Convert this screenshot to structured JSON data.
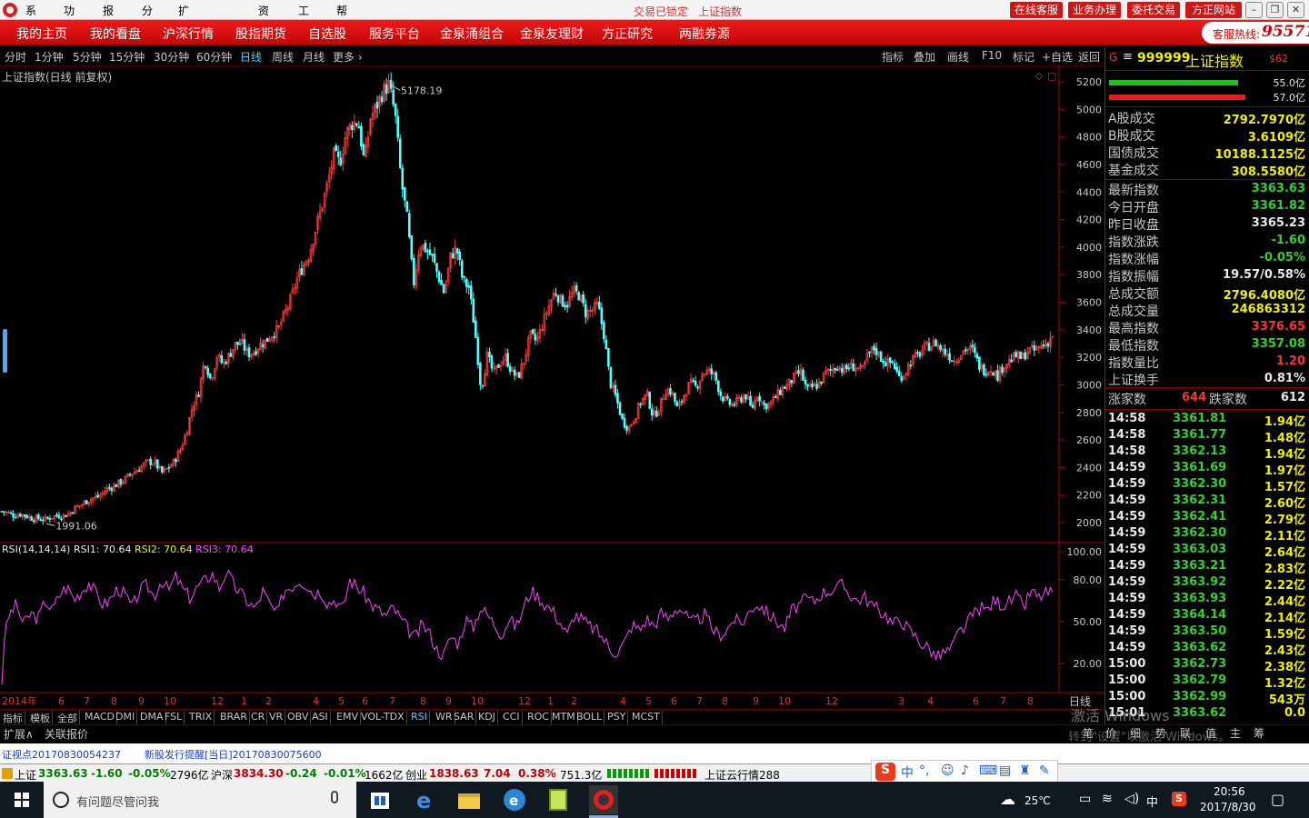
{
  "menu": [
    "系统",
    "功能",
    "报价",
    "分析",
    "扩展市场行情",
    "资讯",
    "工具",
    "帮助"
  ],
  "title_status": {
    "locked": "交易已锁定",
    "index": "上证指数"
  },
  "top_buttons": [
    "在线客服",
    "业务办理",
    "委托交易",
    "方正网站"
  ],
  "nav": [
    "我的主页",
    "我的看盘",
    "沪深行情",
    "股指期货",
    "自选股",
    "服务平台",
    "金泉涌组合",
    "金泉友理财",
    "方正研究",
    "两融券源"
  ],
  "hotline": {
    "label": "客服热线:",
    "number": "95571"
  },
  "periods": [
    "分时",
    "1分钟",
    "5分钟",
    "15分钟",
    "30分钟",
    "60分钟",
    "日线",
    "周线",
    "月线",
    "更多 ›"
  ],
  "active_period": "日线",
  "tools": [
    "指标",
    "叠加",
    "画线",
    "F10",
    "标记",
    "+自选",
    "返回"
  ],
  "chart_title": "上证指数(日线 前复权)",
  "chart_annotations": {
    "high": "5178.19",
    "low": "1991.06"
  },
  "rsi_header": {
    "name": "RSI(14,14,14)",
    "rsi1": "RSI1: 70.64",
    "rsi2": "RSI2: 70.64",
    "rsi3": "RSI3: 70.64"
  },
  "rp": {
    "marker": "G",
    "code": "999999",
    "name": "上证指数",
    "tag": "$62",
    "bar1": "55.0亿",
    "bar2": "57.0亿"
  },
  "volumes": [
    {
      "k": "A股成交",
      "v": "2792.7970亿"
    },
    {
      "k": "B股成交",
      "v": "3.6109亿"
    },
    {
      "k": "国债成交",
      "v": "10188.1125亿"
    },
    {
      "k": "基金成交",
      "v": "308.5580亿"
    }
  ],
  "stats": [
    {
      "k": "最新指数",
      "v": "3363.63",
      "c": "green"
    },
    {
      "k": "今日开盘",
      "v": "3361.82",
      "c": "green"
    },
    {
      "k": "昨日收盘",
      "v": "3365.23",
      "c": "white"
    },
    {
      "k": "指数涨跌",
      "v": "-1.60",
      "c": "green"
    },
    {
      "k": "指数涨幅",
      "v": "-0.05%",
      "c": "green"
    },
    {
      "k": "指数振幅",
      "v": "19.57/0.58%",
      "c": "white"
    },
    {
      "k": "总成交额",
      "v": "2796.4080亿",
      "c": "yellow"
    },
    {
      "k": "总成交量",
      "v": "246863312",
      "c": "yellow"
    },
    {
      "k": "最高指数",
      "v": "3376.65",
      "c": "red"
    },
    {
      "k": "最低指数",
      "v": "3357.08",
      "c": "green"
    },
    {
      "k": "指数量比",
      "v": "1.20",
      "c": "red"
    },
    {
      "k": "上证换手",
      "v": "0.81%",
      "c": "white"
    }
  ],
  "breadth": {
    "up_label": "涨家数",
    "up": "644",
    "down_label": "跌家数",
    "down": "612"
  },
  "ticks": [
    {
      "t": "14:58",
      "p": "3361.81",
      "v": "1.94亿"
    },
    {
      "t": "14:58",
      "p": "3361.77",
      "v": "1.48亿"
    },
    {
      "t": "14:58",
      "p": "3362.13",
      "v": "1.94亿"
    },
    {
      "t": "14:59",
      "p": "3361.69",
      "v": "1.97亿"
    },
    {
      "t": "14:59",
      "p": "3362.30",
      "v": "1.57亿"
    },
    {
      "t": "14:59",
      "p": "3362.31",
      "v": "2.60亿"
    },
    {
      "t": "14:59",
      "p": "3362.41",
      "v": "2.79亿"
    },
    {
      "t": "14:59",
      "p": "3362.30",
      "v": "2.11亿"
    },
    {
      "t": "14:59",
      "p": "3363.03",
      "v": "2.64亿"
    },
    {
      "t": "14:59",
      "p": "3363.21",
      "v": "2.83亿"
    },
    {
      "t": "14:59",
      "p": "3363.92",
      "v": "2.22亿"
    },
    {
      "t": "14:59",
      "p": "3363.93",
      "v": "2.44亿"
    },
    {
      "t": "14:59",
      "p": "3364.14",
      "v": "2.14亿"
    },
    {
      "t": "14:59",
      "p": "3363.50",
      "v": "1.59亿"
    },
    {
      "t": "14:59",
      "p": "3363.62",
      "v": "2.43亿"
    },
    {
      "t": "15:00",
      "p": "3362.73",
      "v": "2.38亿"
    },
    {
      "t": "15:00",
      "p": "3362.79",
      "v": "1.32亿"
    },
    {
      "t": "15:00",
      "p": "3362.99",
      "v": "543万"
    },
    {
      "t": "15:01",
      "p": "3363.62",
      "v": "0.0"
    }
  ],
  "price_axis": [
    "5200",
    "5000",
    "4800",
    "4600",
    "4400",
    "4200",
    "4000",
    "3800",
    "3600",
    "3400",
    "3200",
    "3000",
    "2800",
    "2600",
    "2400",
    "2200",
    "2000"
  ],
  "rsi_axis": [
    "100.00",
    "80.00",
    "50.00",
    "20.00"
  ],
  "date_axis": {
    "start": "2014年",
    "labels": [
      [
        "6",
        64
      ],
      [
        "7",
        92
      ],
      [
        "8",
        122
      ],
      [
        "9",
        152
      ],
      [
        "10",
        180
      ],
      [
        "12",
        232
      ],
      [
        "1",
        265
      ],
      [
        "2",
        292
      ],
      [
        "4",
        344
      ],
      [
        "5",
        372
      ],
      [
        "6",
        398
      ],
      [
        "7",
        428
      ],
      [
        "8",
        462
      ],
      [
        "9",
        490
      ],
      [
        "10",
        518
      ],
      [
        "12",
        570
      ],
      [
        "1",
        602
      ],
      [
        "2",
        628
      ],
      [
        "4",
        682
      ],
      [
        "5",
        710
      ],
      [
        "6",
        738
      ],
      [
        "7",
        766
      ],
      [
        "8",
        794
      ],
      [
        "9",
        828
      ],
      [
        "10",
        856
      ],
      [
        "12",
        908
      ],
      [
        "3",
        988
      ],
      [
        "4",
        1020
      ],
      [
        "6",
        1070
      ],
      [
        "7",
        1100
      ],
      [
        "8",
        1130
      ]
    ],
    "period": "日线"
  },
  "indicator_tabs": [
    "指标",
    "模板",
    "全部",
    "MACD",
    "DMI",
    "DMA",
    "FSL",
    "TRIX",
    "BRAR",
    "CR",
    "VR",
    "OBV",
    "ASI",
    "EMV",
    "VOL-TDX",
    "RSI",
    "WR",
    "SAR",
    "KDJ",
    "CCI",
    "ROC",
    "MTM",
    "BOLL",
    "PSY",
    "MCST"
  ],
  "active_indicator": "RSI",
  "ext_tabs": [
    "扩展∧",
    "关联报价"
  ],
  "right_tabs": [
    "笔",
    "价",
    "细",
    "势",
    "联",
    "值",
    "主",
    "筹"
  ],
  "news": [
    "证视点20170830054237",
    "新股发行提醒[当日]20170830075600"
  ],
  "status_bar": {
    "sh_name": "上证",
    "sh_val": "3363.63",
    "sh_chg": "-1.60",
    "sh_pct": "-0.05%",
    "sh_amt": "2796亿",
    "sz_name": "沪深",
    "sz_val": "3834.30",
    "sz_chg": "-0.24",
    "sz_pct": "-0.01%",
    "sz_amt": "1662亿",
    "cy_name": "创业",
    "cy_val": "1838.63",
    "cy_chg": "7.04",
    "cy_pct": "0.38%",
    "cy_amt": "751.3亿",
    "cloud": "上证云行情288"
  },
  "ime": {
    "lang": "中"
  },
  "taskbar": {
    "search_placeholder": "有问题尽管问我",
    "weather": "25℃",
    "ime": "中",
    "time": "20:56",
    "date": "2017/8/30"
  },
  "watermark": {
    "line1": "激活 Windows",
    "line2": "转到\"设置\"以激活 Windows。"
  },
  "series_close": [
    2081,
    2071,
    2053,
    2062,
    2049,
    2030,
    2030,
    2022,
    2040,
    2052,
    2050,
    2067,
    2111,
    2130,
    2165,
    2180,
    2193,
    2245,
    2258,
    2286,
    2311,
    2355,
    2381,
    2418,
    2444,
    2430,
    2360,
    2393,
    2442,
    2525,
    2651,
    2842,
    2938,
    3185,
    3034,
    3213,
    3148,
    3216,
    3293,
    3305,
    3224,
    3242,
    3291,
    3320,
    3369,
    3405,
    3512,
    3620,
    3765,
    3861,
    3947,
    4121,
    4286,
    4456,
    4668,
    4611,
    4823,
    4898,
    4910,
    4611,
    4941,
    5024,
    5131,
    5178,
    4967,
    4477,
    4193,
    3727,
    4028,
    3985,
    3928,
    3794,
    3663,
    3928,
    3995,
    3758,
    3708,
    3397,
    2965,
    3215,
    3080,
    3156,
    3202,
    3092,
    3052,
    3184,
    3359,
    3316,
    3441,
    3572,
    3683,
    3606,
    3587,
    3678,
    3650,
    3524,
    3539,
    3580,
    3363,
    3017,
    2900,
    2737,
    2687,
    2767,
    2880,
    2930,
    2767,
    2833,
    2965,
    2950,
    2818,
    2929,
    3013,
    2980,
    3085,
    3100,
    3064,
    2928,
    2870,
    2853,
    2891,
    2930,
    2820,
    2938,
    2849,
    2863,
    2916,
    2974,
    3002,
    3058,
    3093,
    2959,
    2986,
    3005,
    3085,
    3106,
    3144,
    3103,
    3135,
    3130,
    3100,
    3222,
    3266,
    3198,
    3157,
    3165,
    3051,
    3090,
    3180,
    3210,
    3261,
    3287,
    3304,
    3250,
    3222,
    3176,
    3230,
    3267,
    3250,
    3141,
    3102,
    3123,
    3062,
    3144,
    3175,
    3210,
    3192,
    3254,
    3247,
    3277,
    3300,
    3363
  ],
  "series_rsi": [
    28,
    55,
    62,
    48,
    56,
    52,
    65,
    58,
    70,
    75,
    66,
    72,
    78,
    70,
    62,
    66,
    74,
    69,
    60,
    72,
    76,
    68,
    80,
    72,
    82,
    73,
    67,
    75,
    79,
    85,
    74,
    86,
    76,
    70,
    64,
    59,
    72,
    62,
    55,
    73,
    75,
    80,
    77,
    70,
    72,
    63,
    66,
    58,
    80,
    75,
    70,
    62,
    58,
    54,
    60,
    52,
    45,
    38,
    48,
    42,
    30,
    26,
    40,
    34,
    52,
    45,
    60,
    55,
    48,
    41,
    52,
    46,
    60,
    72,
    68,
    62,
    58,
    50,
    40,
    55,
    52,
    47,
    44,
    38,
    30,
    28,
    36,
    48,
    44,
    52,
    47,
    56,
    52,
    60,
    58,
    49,
    51,
    55,
    45,
    40,
    44,
    52,
    48,
    56,
    63,
    60,
    54,
    50,
    45,
    58,
    62,
    67,
    64,
    70,
    72,
    74,
    76,
    70,
    65,
    68,
    62,
    58,
    55,
    48,
    52,
    45,
    40,
    34,
    31,
    24,
    28,
    30,
    42,
    47,
    55,
    60,
    58,
    66,
    62,
    64,
    68,
    60,
    72,
    67,
    70,
    71
  ]
}
